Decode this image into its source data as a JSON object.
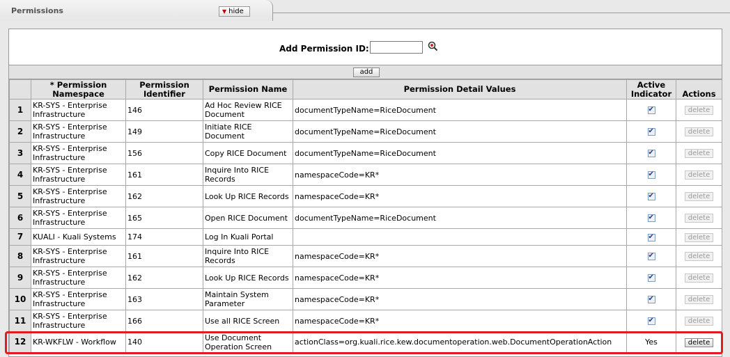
{
  "section": {
    "title": "Permissions",
    "hide_label": "hide"
  },
  "add": {
    "label": "Add Permission ID:",
    "input_value": "",
    "button_label": "add"
  },
  "headers": {
    "num": "",
    "namespace_req": "*",
    "namespace": "Permission Namespace",
    "identifier": "Permission Identifier",
    "name": "Permission Name",
    "details": "Permission Detail Values",
    "active": "Active Indicator",
    "actions": "Actions"
  },
  "rows": [
    {
      "num": "1",
      "namespace": "KR-SYS - Enterprise Infrastructure",
      "id": "146",
      "name": "Ad Hoc Review RICE Document",
      "details": "documentTypeName=RiceDocument",
      "active": true,
      "action": "delete"
    },
    {
      "num": "2",
      "namespace": "KR-SYS - Enterprise Infrastructure",
      "id": "149",
      "name": "Initiate RICE Document",
      "details": "documentTypeName=RiceDocument",
      "active": true,
      "action": "delete"
    },
    {
      "num": "3",
      "namespace": "KR-SYS - Enterprise Infrastructure",
      "id": "156",
      "name": "Copy RICE Document",
      "details": "documentTypeName=RiceDocument",
      "active": true,
      "action": "delete"
    },
    {
      "num": "4",
      "namespace": "KR-SYS - Enterprise Infrastructure",
      "id": "161",
      "name": "Inquire Into RICE Records",
      "details": "namespaceCode=KR*",
      "active": true,
      "action": "delete"
    },
    {
      "num": "5",
      "namespace": "KR-SYS - Enterprise Infrastructure",
      "id": "162",
      "name": "Look Up RICE Records",
      "details": "namespaceCode=KR*",
      "active": true,
      "action": "delete"
    },
    {
      "num": "6",
      "namespace": "KR-SYS - Enterprise Infrastructure",
      "id": "165",
      "name": "Open RICE Document",
      "details": "documentTypeName=RiceDocument",
      "active": true,
      "action": "delete"
    },
    {
      "num": "7",
      "namespace": "KUALI - Kuali Systems",
      "id": "174",
      "name": "Log In Kuali Portal",
      "details": "",
      "active": true,
      "action": "delete",
      "short": true
    },
    {
      "num": "8",
      "namespace": "KR-SYS - Enterprise Infrastructure",
      "id": "161",
      "name": "Inquire Into RICE Records",
      "details": "namespaceCode=KR*",
      "active": true,
      "action": "delete"
    },
    {
      "num": "9",
      "namespace": "KR-SYS - Enterprise Infrastructure",
      "id": "162",
      "name": "Look Up RICE Records",
      "details": "namespaceCode=KR*",
      "active": true,
      "action": "delete"
    },
    {
      "num": "10",
      "namespace": "KR-SYS - Enterprise Infrastructure",
      "id": "163",
      "name": "Maintain System Parameter",
      "details": "namespaceCode=KR*",
      "active": true,
      "action": "delete"
    },
    {
      "num": "11",
      "namespace": "KR-SYS - Enterprise Infrastructure",
      "id": "166",
      "name": "Use all RICE Screen",
      "details": "namespaceCode=KR*",
      "active": true,
      "action": "delete"
    },
    {
      "num": "12",
      "namespace": "KR-WKFLW - Workflow",
      "id": "140",
      "name": "Use Document Operation Screen",
      "details": "actionClass=org.kuali.rice.kew.documentoperation.web.DocumentOperationAction",
      "active": false,
      "active_text": "Yes",
      "action": "delete",
      "highlight": true
    }
  ],
  "colors": {
    "highlight_border": "#e11b22",
    "header_bg": "#e2e2e2"
  }
}
